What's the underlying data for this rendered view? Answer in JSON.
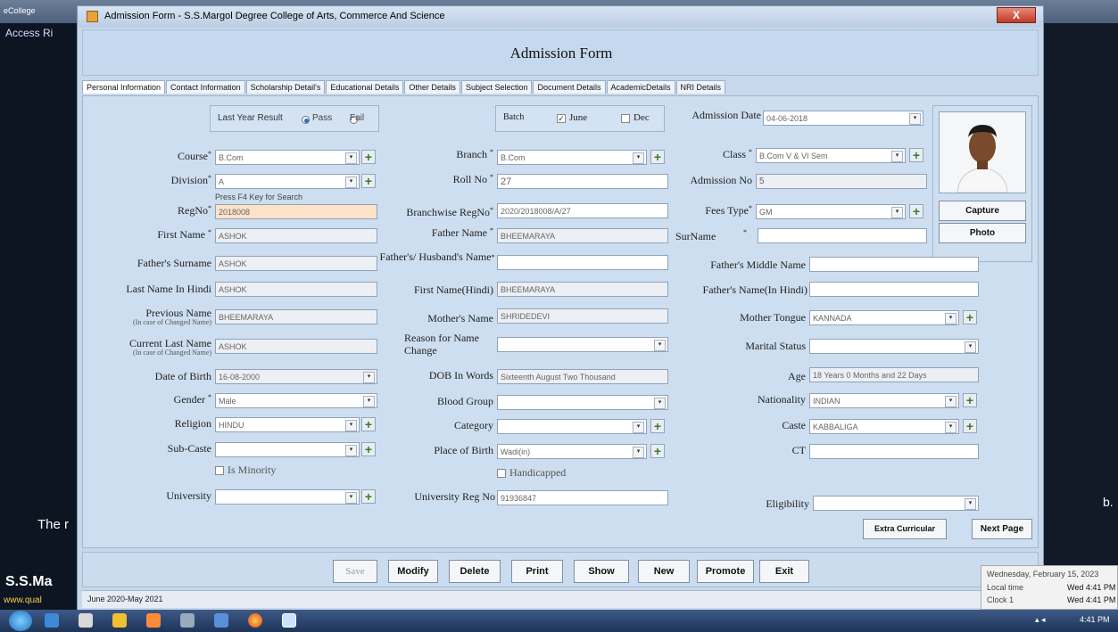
{
  "background": {
    "app_tab": "eCollege",
    "access_text": "Access Ri",
    "left_text_1": "The r",
    "left_text_2": "S.S.Ma",
    "left_text_3": "www.qual",
    "right_text": "b."
  },
  "window": {
    "title": "Admission Form - S.S.Margol Degree College of Arts, Commerce And Science",
    "close_glyph": "X"
  },
  "form": {
    "title": "Admission Form"
  },
  "tabs": [
    "Personal Information",
    "Contact Information",
    "Scholarship Detail's",
    "Educational Details",
    "Other Details",
    "Subject Selection",
    "Document Details",
    "AcademicDetails",
    "NRI Details"
  ],
  "last_year": {
    "label": "Last Year Result",
    "pass": "Pass",
    "fail": "Fail",
    "selected": "Pass"
  },
  "batch": {
    "label": "Batch",
    "june": "June",
    "june_checked": true,
    "dec": "Dec",
    "dec_checked": false
  },
  "fields": {
    "admission_date": {
      "label": "Admission Date",
      "value": "04-06-2018"
    },
    "course": {
      "label": "Course",
      "value": "B.Com"
    },
    "branch": {
      "label": "Branch",
      "value": "B.Com"
    },
    "class": {
      "label": "Class",
      "value": "B.Com V & VI Sem"
    },
    "division": {
      "label": "Division",
      "value": "A"
    },
    "roll_no": {
      "label": "Roll No",
      "value": "27"
    },
    "admission_no": {
      "label": "Admission No",
      "value": "5"
    },
    "regno_hint": "Press F4 Key for Search",
    "regno": {
      "label": "RegNo",
      "value": "2018008"
    },
    "branchwise_regno": {
      "label": "Branchwise RegNo",
      "value": "2020/2018008/A/27"
    },
    "fees_type": {
      "label": "Fees Type",
      "value": "GM"
    },
    "first_name": {
      "label": "First Name",
      "value": "ASHOK"
    },
    "father_name": {
      "label": "Father Name",
      "value": "BHEEMARAYA"
    },
    "surname": {
      "label": "SurName",
      "value": ""
    },
    "fathers_surname": {
      "label": "Father's Surname",
      "value": "ASHOK"
    },
    "husband_name": {
      "label": "Father's/ Husband's Name",
      "value": ""
    },
    "fathers_middle_name": {
      "label": "Father's Middle Name",
      "value": ""
    },
    "last_name_hindi": {
      "label": "Last Name In Hindi",
      "value": "ASHOK"
    },
    "first_name_hindi": {
      "label": "First Name(Hindi)",
      "value": "BHEEMARAYA"
    },
    "fathers_name_hindi": {
      "label": "Father's Name(In Hindi)",
      "value": ""
    },
    "previous_name": {
      "label": "Previous Name",
      "sublabel": "(In case of Changed Name)",
      "value": "BHEEMARAYA"
    },
    "mothers_name": {
      "label": "Mother's Name",
      "value": "SHRIDEDEVI"
    },
    "mother_tongue": {
      "label": "Mother Tongue",
      "value": "KANNADA"
    },
    "current_last_name": {
      "label": "Current Last Name",
      "sublabel": "(In case of Changed Name)",
      "value": "ASHOK"
    },
    "reason_name_change": {
      "label": "Reason for Name Change",
      "value": ""
    },
    "marital_status": {
      "label": "Marital Status",
      "value": ""
    },
    "dob": {
      "label": "Date of Birth",
      "value": "16-08-2000"
    },
    "dob_words": {
      "label": "DOB In Words",
      "value": "Sixteenth August Two Thousand"
    },
    "age": {
      "label": "Age",
      "value": "18 Years 0 Months and 22 Days"
    },
    "gender": {
      "label": "Gender",
      "value": "Male"
    },
    "blood_group": {
      "label": "Blood Group",
      "value": ""
    },
    "nationality": {
      "label": "Nationality",
      "value": "INDIAN"
    },
    "religion": {
      "label": "Religion",
      "value": "HINDU"
    },
    "category": {
      "label": "Category",
      "value": ""
    },
    "caste": {
      "label": "Caste",
      "value": "KABBALIGA"
    },
    "sub_caste": {
      "label": "Sub-Caste",
      "value": ""
    },
    "place_of_birth": {
      "label": "Place of Birth",
      "value": "Wadi(in)"
    },
    "ct": {
      "label": "CT",
      "value": ""
    },
    "is_minority": "Is Minority",
    "handicapped": "Handicapped",
    "university": {
      "label": "University",
      "value": ""
    },
    "university_reg_no": {
      "label": "University Reg No",
      "value": "91936847"
    },
    "eligibility": {
      "label": "Eligibility",
      "value": ""
    }
  },
  "photo": {
    "capture_label": "Capture",
    "photo_label": "Photo"
  },
  "extra_buttons": {
    "extra_curricular": "Extra Curricular",
    "next_page": "Next Page"
  },
  "actions": [
    "Save",
    "Modify",
    "Delete",
    "Print",
    "Show",
    "New",
    "Promote",
    "Exit"
  ],
  "status": {
    "academic_year": "June 2020-May 2021"
  },
  "clock_popup": {
    "date": "Wednesday, February 15, 2023",
    "local_label": "Local time",
    "local_value": "Wed 4:41 PM",
    "clock1_label": "Clock 1",
    "clock1_value": "Wed 4:41 PM"
  },
  "taskbar": {
    "time": "4:41 PM"
  }
}
